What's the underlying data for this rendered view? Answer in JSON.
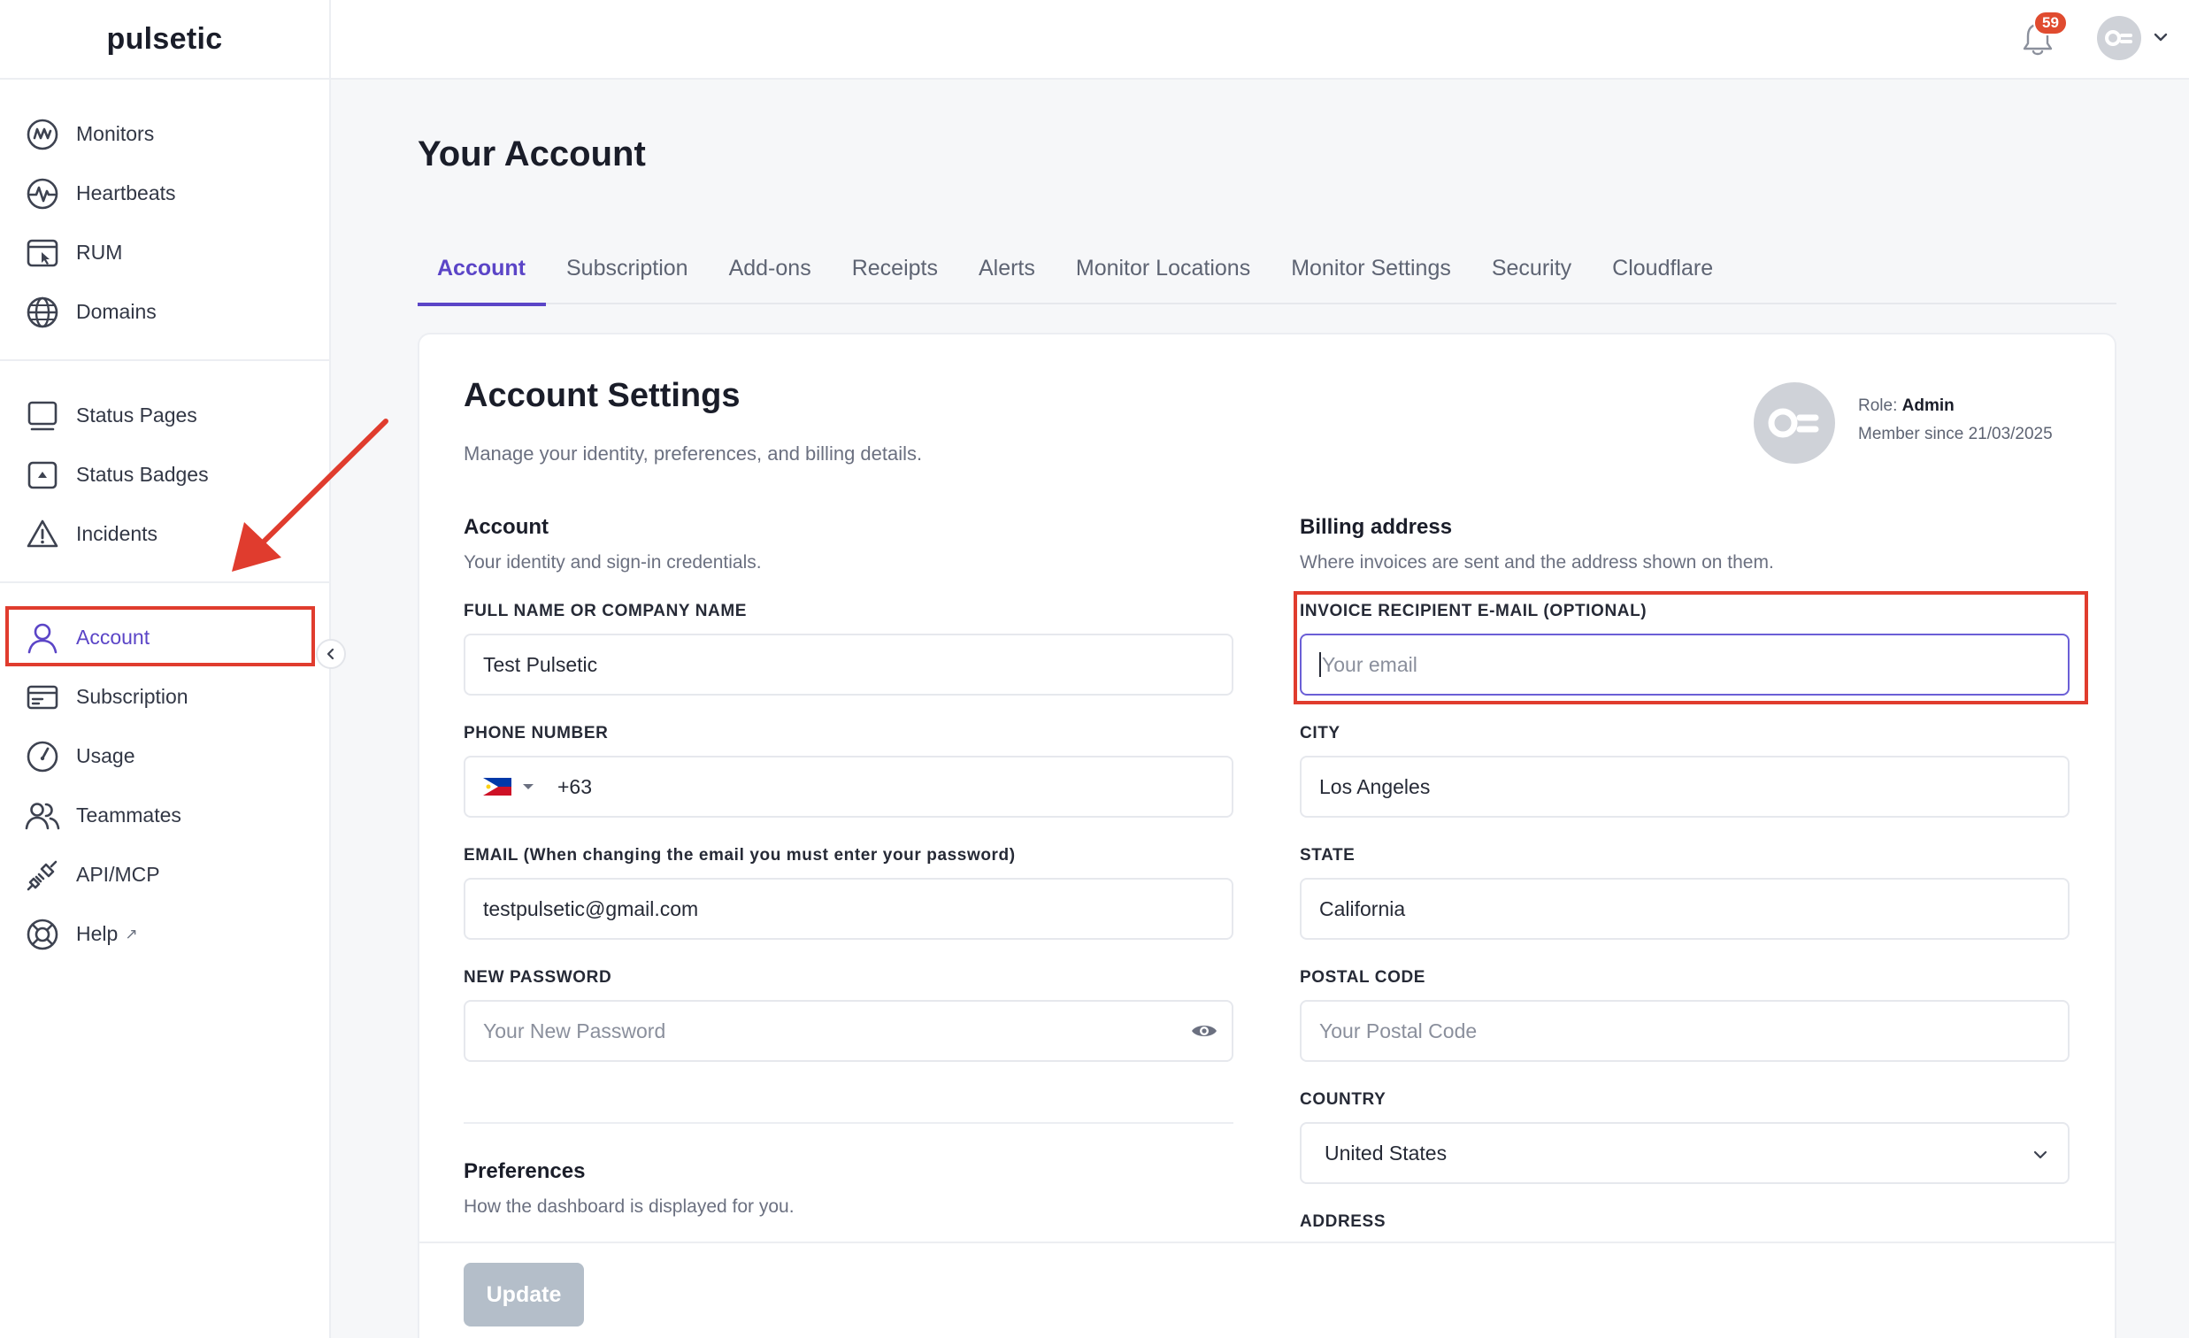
{
  "brand": {
    "name": "pulsetic"
  },
  "sidebar": {
    "groups": [
      [
        {
          "label": "Monitors",
          "icon": "monitors-icon"
        },
        {
          "label": "Heartbeats",
          "icon": "heartbeat-icon"
        },
        {
          "label": "RUM",
          "icon": "rum-icon"
        },
        {
          "label": "Domains",
          "icon": "globe-icon"
        }
      ],
      [
        {
          "label": "Status Pages",
          "icon": "status-page-icon"
        },
        {
          "label": "Status Badges",
          "icon": "status-badge-icon"
        },
        {
          "label": "Incidents",
          "icon": "warning-icon"
        }
      ],
      [
        {
          "label": "Account",
          "icon": "user-icon",
          "active": true
        },
        {
          "label": "Subscription",
          "icon": "card-icon"
        },
        {
          "label": "Usage",
          "icon": "gauge-icon"
        },
        {
          "label": "Teammates",
          "icon": "users-icon"
        },
        {
          "label": "API/MCP",
          "icon": "plug-icon"
        },
        {
          "label": "Help",
          "icon": "lifebuoy-icon",
          "external": "↗"
        }
      ]
    ]
  },
  "topbar": {
    "notification_count": "59"
  },
  "page": {
    "title": "Your Account"
  },
  "tabs": [
    "Account",
    "Subscription",
    "Add-ons",
    "Receipts",
    "Alerts",
    "Monitor Locations",
    "Monitor Settings",
    "Security",
    "Cloudflare"
  ],
  "card": {
    "title": "Account Settings",
    "subtitle": "Manage your identity, preferences, and billing details.",
    "role_label": "Role:",
    "role_value": "Admin",
    "member_since": "Member since 21/03/2025"
  },
  "account": {
    "title": "Account",
    "subtitle": "Your identity and sign-in credentials.",
    "name_label": "FULL NAME OR COMPANY NAME",
    "name_value": "Test Pulsetic",
    "phone_label": "PHONE NUMBER",
    "phone_value": "+63",
    "email_label": "EMAIL (When changing the email you must enter your password)",
    "email_value": "testpulsetic@gmail.com",
    "password_label": "NEW PASSWORD",
    "password_placeholder": "Your New Password"
  },
  "preferences": {
    "title": "Preferences",
    "subtitle": "How the dashboard is displayed for you."
  },
  "billing": {
    "title": "Billing address",
    "subtitle": "Where invoices are sent and the address shown on them.",
    "invoice_email_label": "INVOICE RECIPIENT E-MAIL (OPTIONAL)",
    "invoice_email_placeholder": "Your email",
    "city_label": "CITY",
    "city_value": "Los Angeles",
    "state_label": "STATE",
    "state_value": "California",
    "postal_label": "POSTAL CODE",
    "postal_placeholder": "Your Postal Code",
    "country_label": "COUNTRY",
    "country_value": "United States",
    "address_label": "ADDRESS"
  },
  "actions": {
    "update_label": "Update"
  },
  "colors": {
    "accent": "#5b45c7",
    "highlight": "#e03c2e",
    "badge": "#e04b2f"
  }
}
